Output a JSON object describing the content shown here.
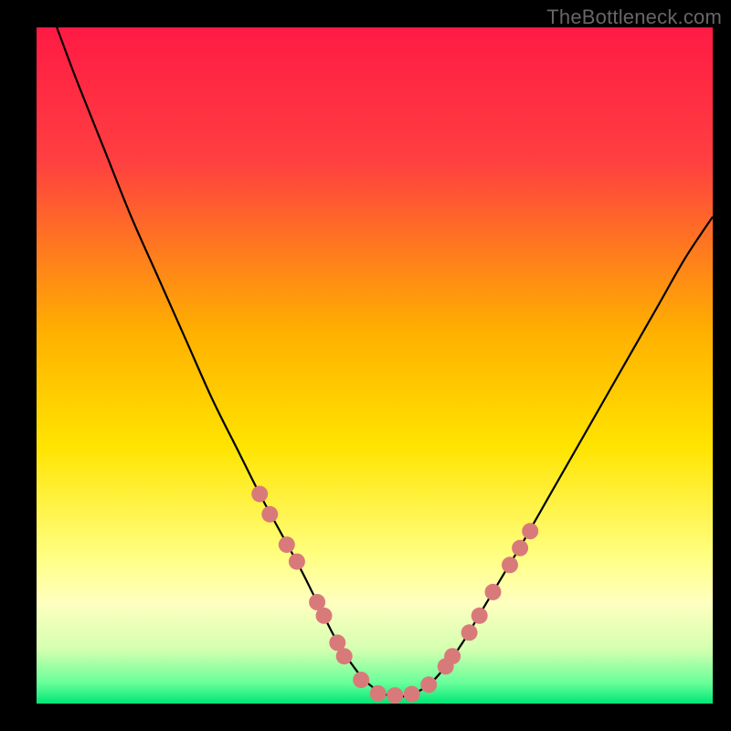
{
  "watermark": "TheBottleneck.com",
  "chart_data": {
    "type": "line",
    "title": "",
    "xlabel": "",
    "ylabel": "",
    "xlim": [
      0,
      100
    ],
    "ylim": [
      0,
      100
    ],
    "background_gradient": {
      "stops": [
        {
          "offset": 0.0,
          "color": "#ff1a44"
        },
        {
          "offset": 0.2,
          "color": "#ff4040"
        },
        {
          "offset": 0.45,
          "color": "#ffb000"
        },
        {
          "offset": 0.62,
          "color": "#ffe400"
        },
        {
          "offset": 0.78,
          "color": "#ffff80"
        },
        {
          "offset": 0.85,
          "color": "#ffffc0"
        },
        {
          "offset": 0.92,
          "color": "#d4ffb0"
        },
        {
          "offset": 0.97,
          "color": "#66ff99"
        },
        {
          "offset": 1.0,
          "color": "#00e676"
        }
      ]
    },
    "series": [
      {
        "name": "curve",
        "x": [
          3,
          6,
          10,
          14,
          18,
          22,
          26,
          30,
          33,
          36,
          39,
          41.5,
          44,
          46.5,
          49,
          52,
          55,
          58,
          60.5,
          63,
          66,
          69,
          72,
          76,
          80,
          84,
          88,
          92,
          96,
          100
        ],
        "y": [
          100,
          92,
          82,
          72,
          63,
          54,
          45,
          37,
          31,
          25.5,
          20,
          15,
          10,
          6,
          3,
          1.2,
          1.2,
          2.8,
          5.5,
          9,
          14,
          19,
          24,
          31,
          38,
          45,
          52,
          59,
          66,
          72
        ]
      }
    ],
    "markers": {
      "name": "highlight-dots",
      "color": "#d97a7a",
      "radius": 9,
      "points": [
        {
          "x": 33.0,
          "y": 31.0
        },
        {
          "x": 34.5,
          "y": 28.0
        },
        {
          "x": 37.0,
          "y": 23.5
        },
        {
          "x": 38.5,
          "y": 21.0
        },
        {
          "x": 41.5,
          "y": 15.0
        },
        {
          "x": 42.5,
          "y": 13.0
        },
        {
          "x": 44.5,
          "y": 9.0
        },
        {
          "x": 45.5,
          "y": 7.0
        },
        {
          "x": 48.0,
          "y": 3.5
        },
        {
          "x": 50.5,
          "y": 1.5
        },
        {
          "x": 53.0,
          "y": 1.2
        },
        {
          "x": 55.5,
          "y": 1.4
        },
        {
          "x": 58.0,
          "y": 2.8
        },
        {
          "x": 60.5,
          "y": 5.5
        },
        {
          "x": 61.5,
          "y": 7.0
        },
        {
          "x": 64.0,
          "y": 10.5
        },
        {
          "x": 65.5,
          "y": 13.0
        },
        {
          "x": 67.5,
          "y": 16.5
        },
        {
          "x": 70.0,
          "y": 20.5
        },
        {
          "x": 71.5,
          "y": 23.0
        },
        {
          "x": 73.0,
          "y": 25.5
        }
      ]
    }
  }
}
